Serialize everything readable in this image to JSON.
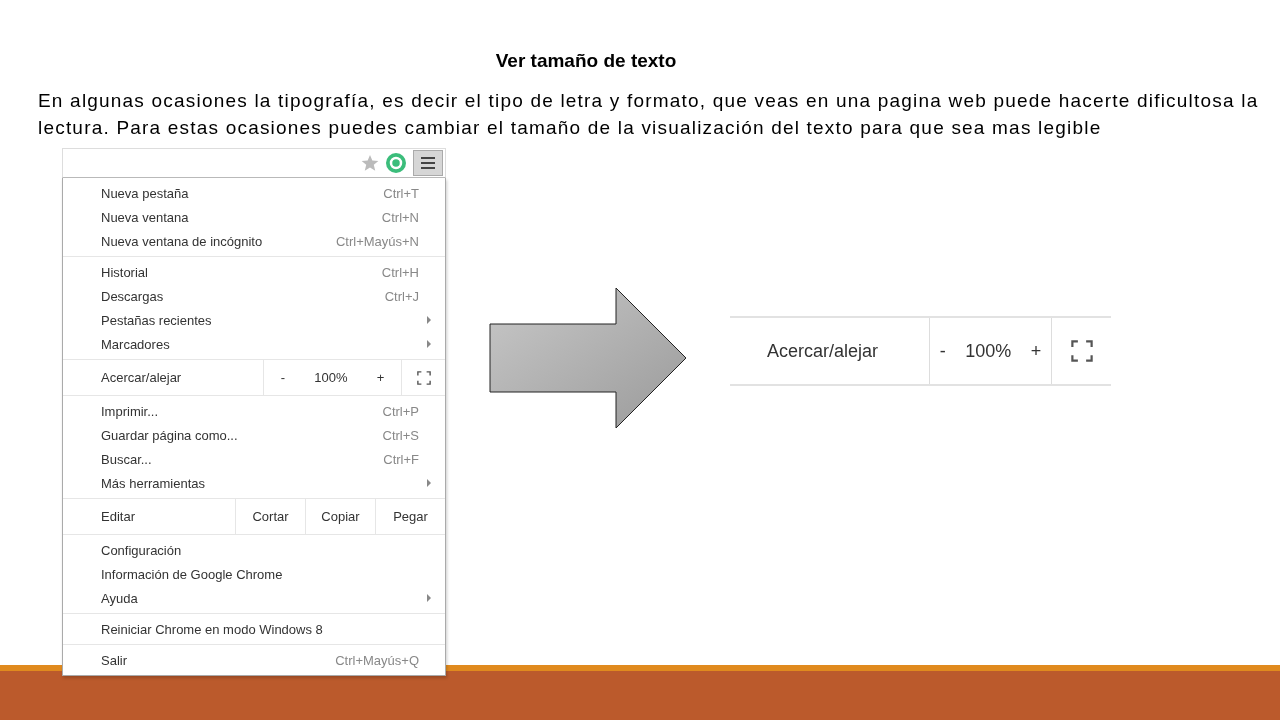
{
  "slide": {
    "title": "Ver tamaño de texto",
    "body": "En algunas ocasiones la tipografía, es decir el tipo de letra y formato, que veas en una pagina web puede hacerte dificultosa la lectura. Para estas ocasiones puedes cambiar el tamaño de la visualización del texto para que sea mas legible"
  },
  "browser_menu": {
    "sections": [
      [
        {
          "kind": "item",
          "label": "Nueva pestaña",
          "shortcut": "Ctrl+T",
          "has_submenu": false
        },
        {
          "kind": "item",
          "label": "Nueva ventana",
          "shortcut": "Ctrl+N",
          "has_submenu": false
        },
        {
          "kind": "item",
          "label": "Nueva ventana de incógnito",
          "shortcut": "Ctrl+Mayús+N",
          "has_submenu": false
        }
      ],
      [
        {
          "kind": "item",
          "label": "Historial",
          "shortcut": "Ctrl+H",
          "has_submenu": false
        },
        {
          "kind": "item",
          "label": "Descargas",
          "shortcut": "Ctrl+J",
          "has_submenu": false
        },
        {
          "kind": "item",
          "label": "Pestañas recientes",
          "has_submenu": true
        },
        {
          "kind": "item",
          "label": "Marcadores",
          "has_submenu": true
        }
      ],
      [
        {
          "kind": "zoom",
          "label": "Acercar/alejar",
          "minus": "-",
          "value": "100%",
          "plus": "+"
        }
      ],
      [
        {
          "kind": "item",
          "label": "Imprimir...",
          "shortcut": "Ctrl+P",
          "has_submenu": false
        },
        {
          "kind": "item",
          "label": "Guardar página como...",
          "shortcut": "Ctrl+S",
          "has_submenu": false
        },
        {
          "kind": "item",
          "label": "Buscar...",
          "shortcut": "Ctrl+F",
          "has_submenu": false
        },
        {
          "kind": "item",
          "label": "Más herramientas",
          "has_submenu": true
        }
      ],
      [
        {
          "kind": "edit",
          "label": "Editar",
          "buttons": [
            "Cortar",
            "Copiar",
            "Pegar"
          ]
        }
      ],
      [
        {
          "kind": "item",
          "label": "Configuración",
          "has_submenu": false
        },
        {
          "kind": "item",
          "label": "Información de Google Chrome",
          "has_submenu": false
        },
        {
          "kind": "item",
          "label": "Ayuda",
          "has_submenu": true
        }
      ],
      [
        {
          "kind": "item",
          "label": "Reiniciar Chrome en modo Windows 8",
          "has_submenu": false
        }
      ],
      [
        {
          "kind": "item",
          "label": "Salir",
          "shortcut": "Ctrl+Mayús+Q",
          "has_submenu": false
        }
      ]
    ]
  },
  "zoom_detail": {
    "label": "Acercar/alejar",
    "minus": "-",
    "value": "100%",
    "plus": "+"
  }
}
